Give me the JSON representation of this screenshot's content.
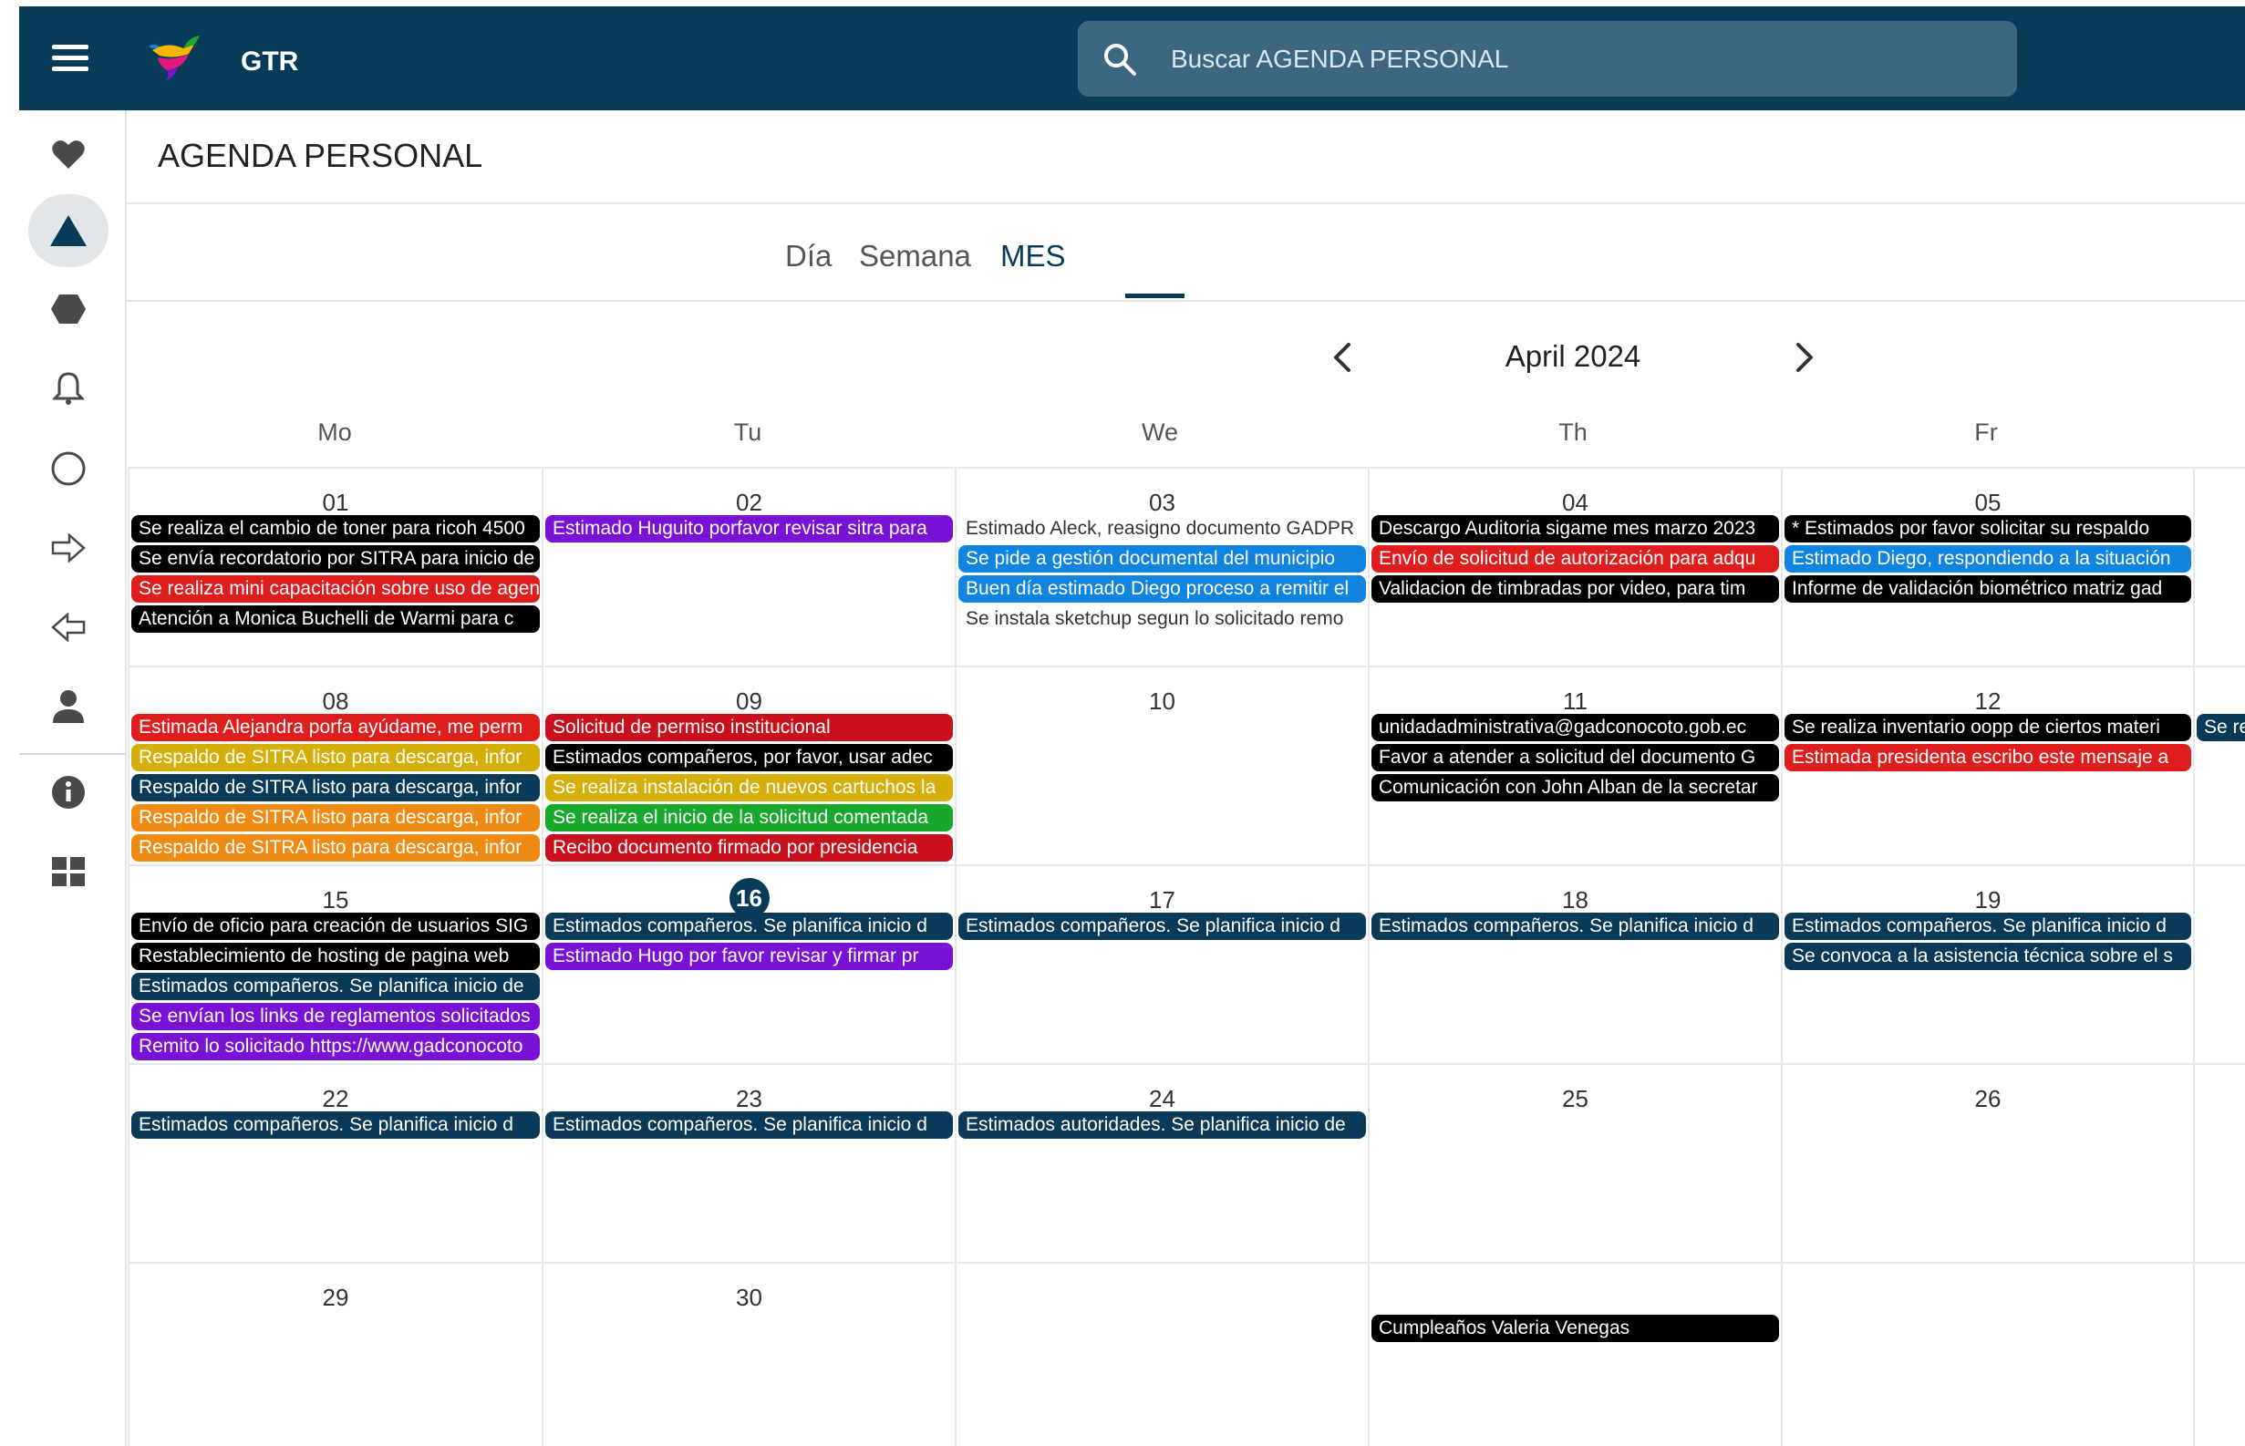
{
  "header": {
    "app_name": "GTR",
    "search_placeholder": "Buscar AGENDA PERSONAL"
  },
  "sidebar": {
    "items": [
      {
        "icon": "heart-icon"
      },
      {
        "icon": "triangle-icon",
        "active": true
      },
      {
        "icon": "hexagon-icon"
      },
      {
        "icon": "bell-icon"
      },
      {
        "icon": "circle-icon"
      },
      {
        "icon": "arrow-right-icon"
      },
      {
        "icon": "arrow-left-icon"
      },
      {
        "icon": "person-icon"
      },
      {
        "icon": "info-icon"
      },
      {
        "icon": "grid-icon"
      }
    ]
  },
  "page_title": "AGENDA PERSONAL",
  "tabs": [
    "Día",
    "Semana",
    "MES"
  ],
  "active_tab": "MES",
  "month_label": "April 2024",
  "weekdays": [
    "Mo",
    "Tu",
    "We",
    "Th",
    "Fr"
  ],
  "colors": {
    "black": "#000000",
    "purple": "#7a12d6",
    "blue": "#1184e0",
    "red": "#df1d1d",
    "navy": "#0a3a57",
    "gold": "#d6ae08",
    "orange": "#ef8a12",
    "green": "#17a82c",
    "darkred": "#c9101c"
  },
  "weeks": [
    [
      {
        "day": "01",
        "events": [
          {
            "text": "Se realiza el cambio de toner para ricoh 4500",
            "color": "black"
          },
          {
            "text": "Se envía recordatorio por SITRA para inicio de",
            "color": "black"
          },
          {
            "text": "Se realiza mini capacitación sobre uso de agenda",
            "color": "red"
          },
          {
            "text": "Atención a Monica Buchelli de Warmi para c",
            "color": "black"
          }
        ]
      },
      {
        "day": "02",
        "events": [
          {
            "text": "Estimado Huguito porfavor revisar sitra para",
            "color": "purple"
          }
        ]
      },
      {
        "day": "03",
        "events": [
          {
            "text": "Estimado Aleck, reasigno documento GADPR",
            "color": "plain"
          },
          {
            "text": "Se pide a gestión documental del municipio",
            "color": "blue"
          },
          {
            "text": "Buen día estimado Diego proceso a remitir el",
            "color": "blue"
          },
          {
            "text": "Se instala sketchup segun lo solicitado remo",
            "color": "plain"
          }
        ]
      },
      {
        "day": "04",
        "events": [
          {
            "text": "Descargo Auditoria sigame mes marzo 2023",
            "color": "black"
          },
          {
            "text": "Envío de solicitud de autorización para adqu",
            "color": "red"
          },
          {
            "text": "Validacion de timbradas por video, para tim",
            "color": "black"
          }
        ]
      },
      {
        "day": "05",
        "events": [
          {
            "text": "* Estimados por favor solicitar su respaldo",
            "color": "black"
          },
          {
            "text": "Estimado Diego, respondiendo a la situación",
            "color": "blue"
          },
          {
            "text": "Informe de validación biométrico matriz gad",
            "color": "black"
          }
        ]
      }
    ],
    [
      {
        "day": "08",
        "events": [
          {
            "text": "Estimada Alejandra porfa ayúdame, me perm",
            "color": "red"
          },
          {
            "text": "Respaldo de SITRA listo para descarga, infor",
            "color": "gold"
          },
          {
            "text": "Respaldo de SITRA listo para descarga, infor",
            "color": "navy"
          },
          {
            "text": "Respaldo de SITRA listo para descarga, infor",
            "color": "orange"
          },
          {
            "text": "Respaldo de SITRA listo para descarga, infor",
            "color": "orange"
          }
        ]
      },
      {
        "day": "09",
        "events": [
          {
            "text": "Solicitud de permiso institucional",
            "color": "darkred"
          },
          {
            "text": "Estimados compañeros, por favor, usar adec",
            "color": "black"
          },
          {
            "text": "Se realiza instalación de nuevos cartuchos la",
            "color": "gold"
          },
          {
            "text": "Se realiza el inicio de la solicitud comentada",
            "color": "green"
          },
          {
            "text": "Recibo documento firmado por presidencia",
            "color": "darkred"
          }
        ]
      },
      {
        "day": "10",
        "events": []
      },
      {
        "day": "11",
        "events": [
          {
            "text": "unidadadministrativa@gadconocoto.gob.ec",
            "color": "black"
          },
          {
            "text": "Favor a atender a solicitud del documento G",
            "color": "black"
          },
          {
            "text": "Comunicación con John Alban de la secretar",
            "color": "black"
          }
        ]
      },
      {
        "day": "12",
        "events": [
          {
            "text": "Se realiza inventario oopp de ciertos materi",
            "color": "black"
          },
          {
            "text": "Estimada presidenta escribo este mensaje a",
            "color": "red"
          }
        ]
      }
    ],
    [
      {
        "day": "15",
        "events": [
          {
            "text": "Envío de oficio para creación de usuarios SIG",
            "color": "black"
          },
          {
            "text": "Restablecimiento de hosting de pagina web",
            "color": "black"
          },
          {
            "text": "Estimados compañeros. Se planifica inicio de",
            "color": "navy"
          },
          {
            "text": "Se envían los links de reglamentos solicitados",
            "color": "purple"
          },
          {
            "text": "Remito lo solicitado https://www.gadconocoto",
            "color": "purple"
          }
        ]
      },
      {
        "day": "16",
        "today": true,
        "events": [
          {
            "text": "Estimados compañeros. Se planifica inicio d",
            "color": "navy"
          },
          {
            "text": "Estimado Hugo por favor revisar y firmar pr",
            "color": "purple"
          }
        ]
      },
      {
        "day": "17",
        "events": [
          {
            "text": "Estimados compañeros. Se planifica inicio d",
            "color": "navy"
          }
        ]
      },
      {
        "day": "18",
        "events": [
          {
            "text": "Estimados compañeros. Se planifica inicio d",
            "color": "navy"
          }
        ]
      },
      {
        "day": "19",
        "events": [
          {
            "text": "Estimados compañeros. Se planifica inicio d",
            "color": "navy"
          },
          {
            "text": "Se convoca a la asistencia técnica sobre el s",
            "color": "navy"
          }
        ]
      }
    ],
    [
      {
        "day": "22",
        "events": [
          {
            "text": "Estimados compañeros. Se planifica inicio d",
            "color": "navy"
          }
        ]
      },
      {
        "day": "23",
        "events": [
          {
            "text": "Estimados compañeros. Se planifica inicio d",
            "color": "navy"
          }
        ]
      },
      {
        "day": "24",
        "events": [
          {
            "text": "Estimados autoridades. Se planifica inicio de",
            "color": "navy"
          }
        ]
      },
      {
        "day": "25",
        "events": []
      },
      {
        "day": "26",
        "events": []
      }
    ],
    [
      {
        "day": "29",
        "events": []
      },
      {
        "day": "30",
        "events": []
      },
      {
        "day": "",
        "events": []
      },
      {
        "day": "",
        "events": [
          {
            "text": "Cumpleaños Valeria Venegas",
            "color": "black"
          }
        ]
      },
      {
        "day": "",
        "events": []
      }
    ]
  ],
  "saturday_overflow": {
    "text": "Se re",
    "color": "navy"
  }
}
